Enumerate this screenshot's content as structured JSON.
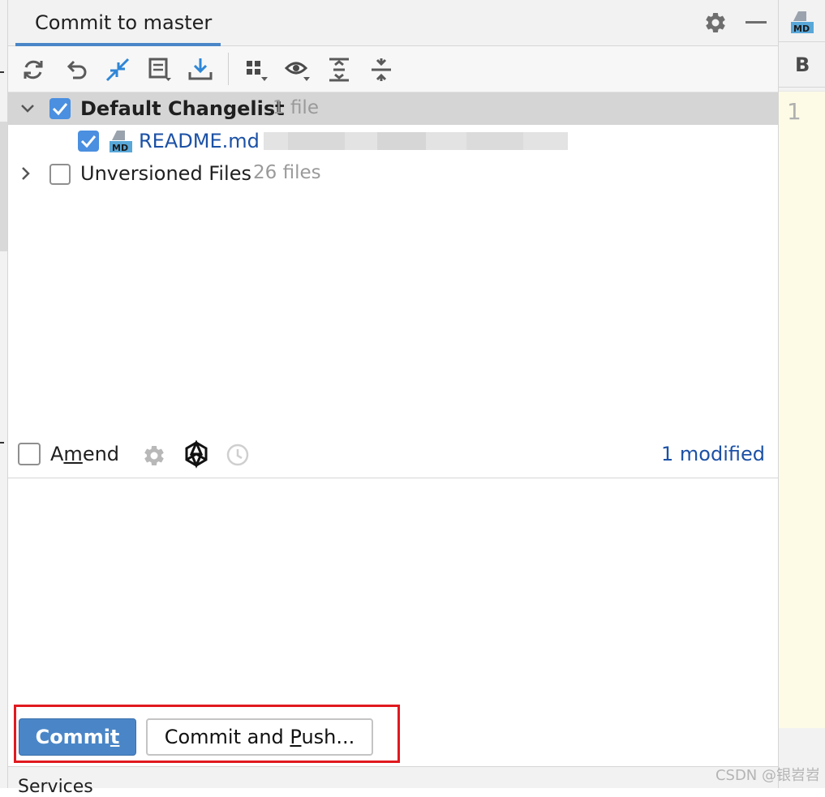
{
  "header": {
    "tab_title": "Commit to master"
  },
  "toolbar": {
    "buttons": [
      "refresh-icon",
      "rollback-icon",
      "show-diff-icon",
      "changelist-icon",
      "update-icon",
      "group-by-icon",
      "view-options-icon",
      "expand-all-icon",
      "collapse-all-icon"
    ]
  },
  "changes": {
    "changelist": {
      "name": "Default Changelist",
      "count": "1 file",
      "checked": true,
      "expanded": true
    },
    "file": {
      "name": "README.md",
      "badge": "MD",
      "checked": true
    },
    "unversioned": {
      "name": "Unversioned Files",
      "count": "26 files",
      "checked": false,
      "expanded": false
    }
  },
  "amend": {
    "label_before": "A",
    "label_underlined": "m",
    "label_after": "end",
    "checked": false,
    "modified_text": "1 modified"
  },
  "commit_message": {
    "value": ""
  },
  "actions": {
    "commit_before": "Commi",
    "commit_underlined": "t",
    "commit_after": "",
    "commit_push_before": "Commit and ",
    "commit_push_underlined": "P",
    "commit_push_after": "ush..."
  },
  "bottom": {
    "services_label": "Services"
  },
  "editor": {
    "file_badge": "MD",
    "structure_letter": "B",
    "line_number": "1"
  },
  "watermark": "CSDN @银岧岧",
  "colors": {
    "accent": "#4a86c7",
    "link": "#1c51a6",
    "highlight": "#e0191f",
    "muted": "#9a9a9a"
  }
}
